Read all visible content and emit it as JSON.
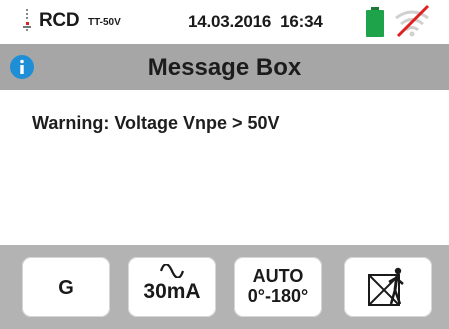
{
  "status": {
    "mode": "RCD",
    "submode": "TT-50V",
    "date": "14.03.2016",
    "time": "16:34",
    "battery_color": "#1fa34a",
    "battery_icon": "battery-icon",
    "wifi_icon": "wifi-disabled-icon",
    "wifi_slash_color": "#e02020"
  },
  "titlebar": {
    "title": "Message Box",
    "info_icon": "info-icon",
    "bg_color": "#a6a6a6",
    "info_color": "#1e8fd6"
  },
  "content": {
    "message": "Warning: Voltage Vnpe > 50V"
  },
  "softkeys": [
    {
      "label": "G"
    },
    {
      "icon": "sine-wave-icon",
      "label": "30mA"
    },
    {
      "label_line1": "AUTO",
      "label_line2": "0°-180°"
    },
    {
      "icon": "person-crossed-icon"
    }
  ]
}
